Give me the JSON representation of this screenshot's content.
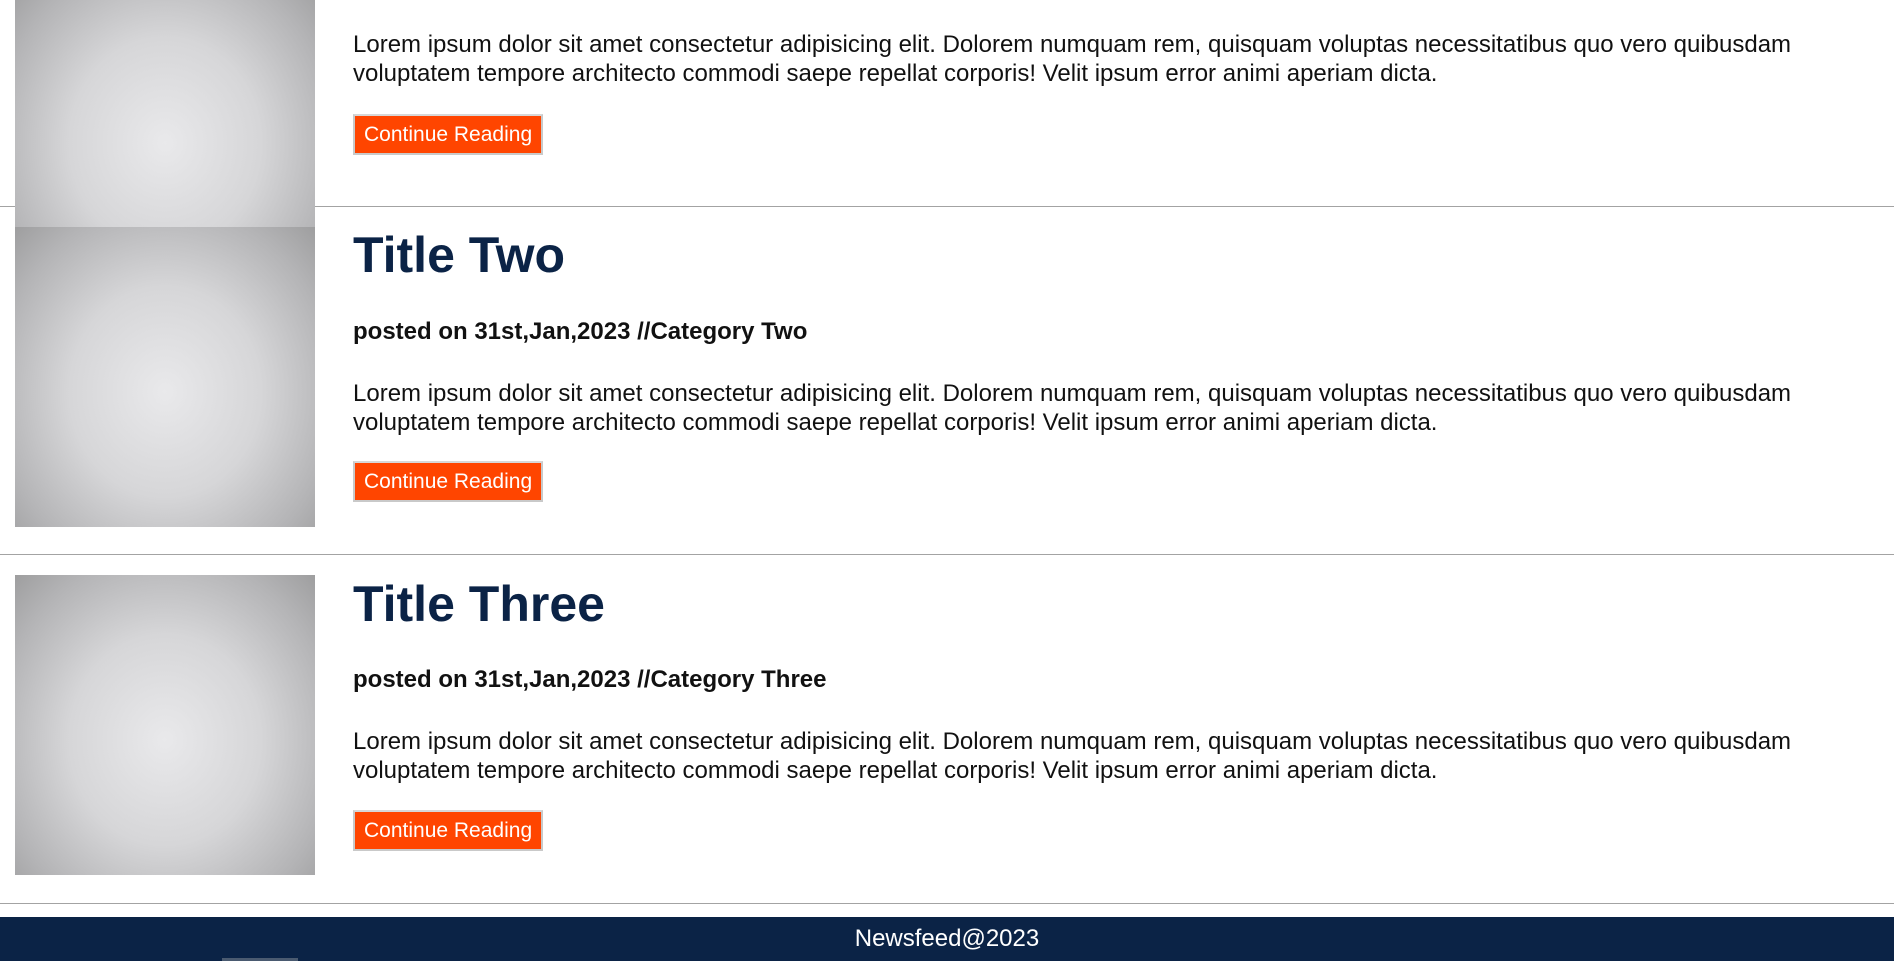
{
  "posts": [
    {
      "title": "",
      "meta": "",
      "excerpt": "Lorem ipsum dolor sit amet consectetur adipisicing elit. Dolorem numquam rem, quisquam voluptas necessitatibus quo vero quibusdam voluptatem tempore architecto commodi saepe repellat corporis! Velit ipsum error animi aperiam dicta.",
      "button": "Continue Reading"
    },
    {
      "title": "Title Two",
      "meta": "posted on 31st,Jan,2023 //Category Two",
      "excerpt": "Lorem ipsum dolor sit amet consectetur adipisicing elit. Dolorem numquam rem, quisquam voluptas necessitatibus quo vero quibusdam voluptatem tempore architecto commodi saepe repellat corporis! Velit ipsum error animi aperiam dicta.",
      "button": "Continue Reading"
    },
    {
      "title": "Title Three",
      "meta": "posted on 31st,Jan,2023 //Category Three",
      "excerpt": "Lorem ipsum dolor sit amet consectetur adipisicing elit. Dolorem numquam rem, quisquam voluptas necessitatibus quo vero quibusdam voluptatem tempore architecto commodi saepe repellat corporis! Velit ipsum error animi aperiam dicta.",
      "button": "Continue Reading"
    }
  ],
  "footer": {
    "text": "Newsfeed@2023"
  },
  "colors": {
    "accent": "#ff4500",
    "navy": "#0b2346"
  }
}
